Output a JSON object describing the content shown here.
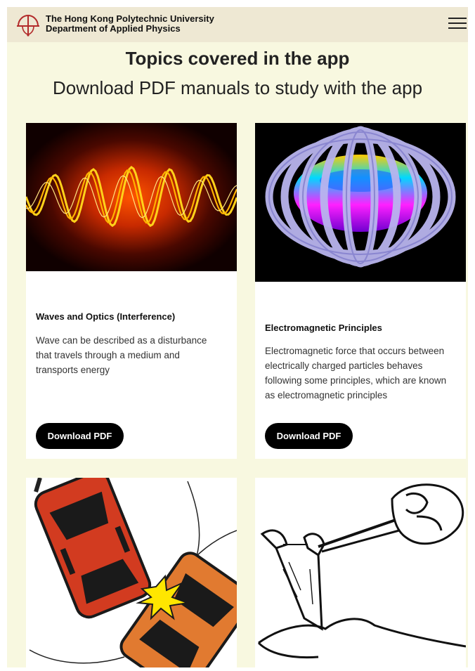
{
  "header": {
    "university": "The Hong Kong Polytechnic University",
    "department": "Department of Applied Physics",
    "logo_icon": "polyu-logo-icon",
    "menu_icon": "hamburger-menu-icon"
  },
  "main": {
    "title": "Topics covered in the app",
    "subtitle": "Download PDF manuals to study with the app"
  },
  "cards": [
    {
      "image": "wave-interference-image",
      "title": "Waves and Optics (Interference)",
      "description": "Wave can be described as a disturbance that travels through a medium and transports energy",
      "button_label": "Download PDF"
    },
    {
      "image": "tokamak-coils-image",
      "title": "Electromagnetic Principles",
      "description": "Electromagnetic force that occurs between electrically charged particles behaves following some principles, which are known as electromagnetic principles",
      "button_label": "Download PDF"
    },
    {
      "image": "car-collision-image"
    },
    {
      "image": "slingshot-image"
    }
  ],
  "colors": {
    "page_background": "#f8f8e0",
    "header_background": "#eee8d3",
    "card_background": "#ffffff",
    "button_background": "#000000",
    "logo_red": "#b22a2a"
  }
}
